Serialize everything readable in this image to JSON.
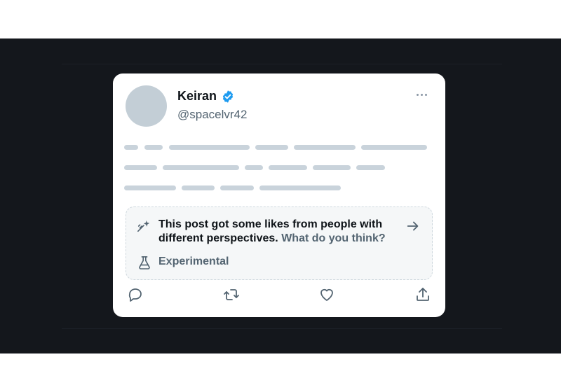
{
  "post": {
    "author": {
      "name": "Keiran",
      "handle": "@spacelvr42",
      "verified": true
    },
    "more_icon": "more-horizontal-icon",
    "note": {
      "icon": "sparkle-icon",
      "text_main": "This post got some likes from people with different perspectives.",
      "link_text": "What do you think?",
      "arrow_icon": "arrow-right-icon",
      "label_icon": "flask-icon",
      "label": "Experimental"
    },
    "actions": [
      {
        "name": "reply",
        "icon": "reply-icon"
      },
      {
        "name": "repost",
        "icon": "repost-icon"
      },
      {
        "name": "like",
        "icon": "heart-icon"
      },
      {
        "name": "share",
        "icon": "share-icon"
      }
    ]
  },
  "colors": {
    "background_dark": "#14171c",
    "card": "#ffffff",
    "verified_blue": "#1d9bf0",
    "muted_text": "#536471",
    "placeholder": "#c9d3db",
    "icon": "#536471"
  }
}
